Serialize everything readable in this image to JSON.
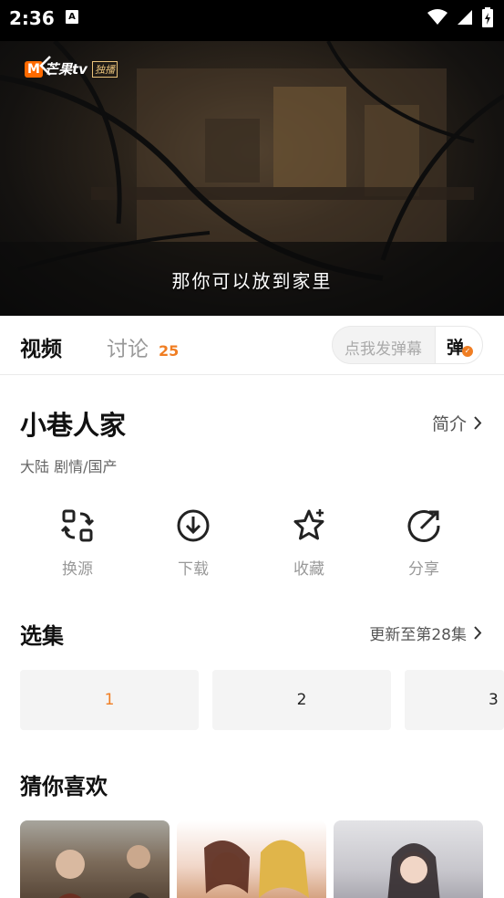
{
  "status_bar": {
    "time": "2:36",
    "notif": "A"
  },
  "player": {
    "logo_m": "M",
    "logo_text": "芒果tv",
    "logo_badge": "独播",
    "subtitle": "那你可以放到家里"
  },
  "tabs": {
    "video": "视频",
    "discuss": "讨论",
    "discuss_count": "25",
    "danmu_placeholder": "点我发弹幕",
    "danmu_button": "弹"
  },
  "show": {
    "title": "小巷人家",
    "intro_label": "简介",
    "meta": "大陆  剧情/国产"
  },
  "actions": [
    {
      "label": "换源",
      "icon": "switch-source-icon"
    },
    {
      "label": "下载",
      "icon": "download-icon"
    },
    {
      "label": "收藏",
      "icon": "star-icon"
    },
    {
      "label": "分享",
      "icon": "share-icon"
    }
  ],
  "episodes": {
    "title": "选集",
    "update_text": "更新至第28集",
    "items": [
      "1",
      "2",
      "3"
    ],
    "active_index": 0
  },
  "recommend": {
    "title": "猜你喜欢"
  },
  "colors": {
    "accent": "#f07e23",
    "logo": "#ff6a00"
  }
}
